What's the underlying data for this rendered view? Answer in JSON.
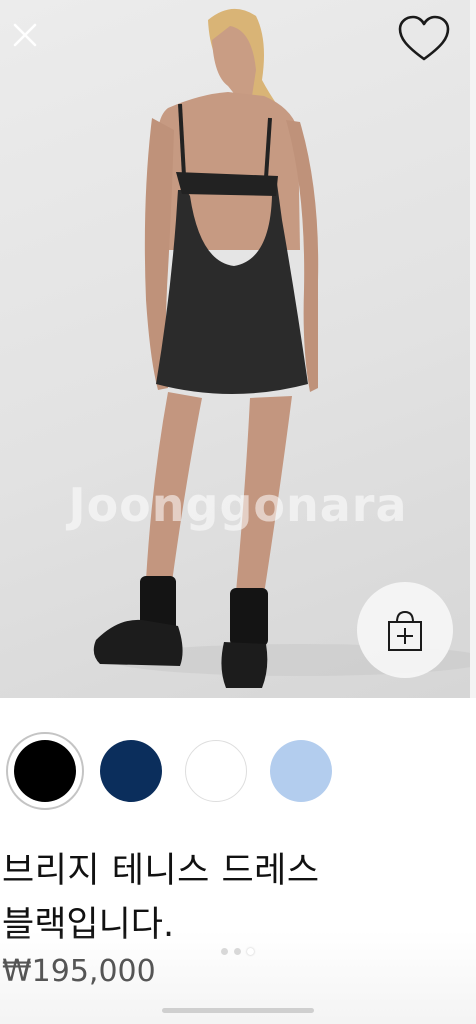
{
  "product": {
    "title": "브리지 테니스 드레스",
    "subtitle": "블랙입니다.",
    "price": "₩195,000"
  },
  "photo": {
    "watermark": "Joonggonara"
  },
  "colors": {
    "swatches": [
      "#000000",
      "#0b2e5c",
      "#ffffff",
      "#b3cdee"
    ],
    "selected_index": 0
  },
  "carousel": {
    "dot_count": 3,
    "active_dot": 3
  },
  "icons": {
    "close": "close-icon",
    "favorite": "heart-icon",
    "add_to_bag": "shopping-bag-plus-icon"
  }
}
